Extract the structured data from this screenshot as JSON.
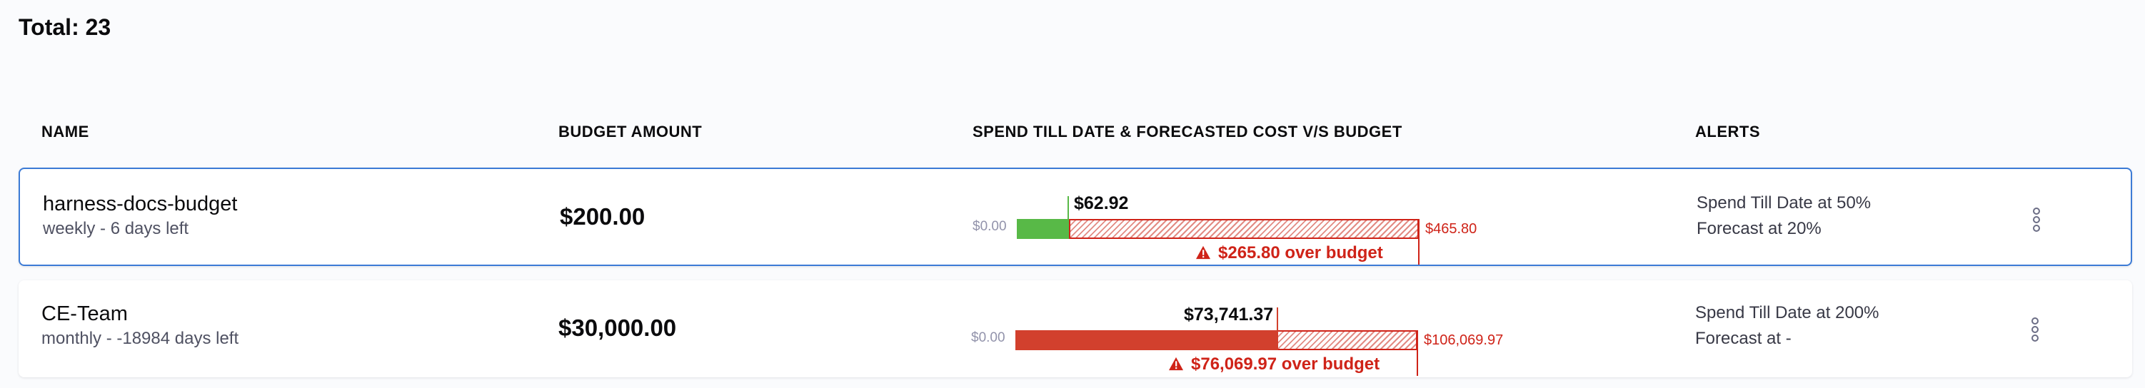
{
  "total_label": "Total: 23",
  "columns": {
    "name": "NAME",
    "budget_amount": "BUDGET AMOUNT",
    "spend": "SPEND TILL DATE & FORECASTED COST V/S BUDGET",
    "alerts": "ALERTS"
  },
  "rows": [
    {
      "name": "harness-docs-budget",
      "subtitle": "weekly - 6 days left",
      "amount": "$200.00",
      "zero_label": "$0.00",
      "spend_label": "$62.92",
      "forecast_label": "$465.80",
      "over_label": "$265.80 over budget",
      "spend_value": 62.92,
      "budget_value": 200.0,
      "forecast_value": 465.8,
      "spend_color": "#58b947",
      "alert_1": "Spend Till Date at 50%",
      "alert_2": "Forecast at 20%",
      "selected": true
    },
    {
      "name": "CE-Team",
      "subtitle": "monthly - -18984 days left",
      "amount": "$30,000.00",
      "zero_label": "$0.00",
      "spend_label": "$73,741.37",
      "forecast_label": "$106,069.97",
      "over_label": "$76,069.97 over budget",
      "spend_value": 73741.37,
      "budget_value": 30000.0,
      "forecast_value": 106069.97,
      "spend_color": "#d2402d",
      "alert_1": "Spend Till Date at 200%",
      "alert_2": "Forecast at -",
      "selected": false
    }
  ],
  "colors": {
    "over_budget": "#cf2318",
    "selected_border": "#3c7bd6"
  }
}
